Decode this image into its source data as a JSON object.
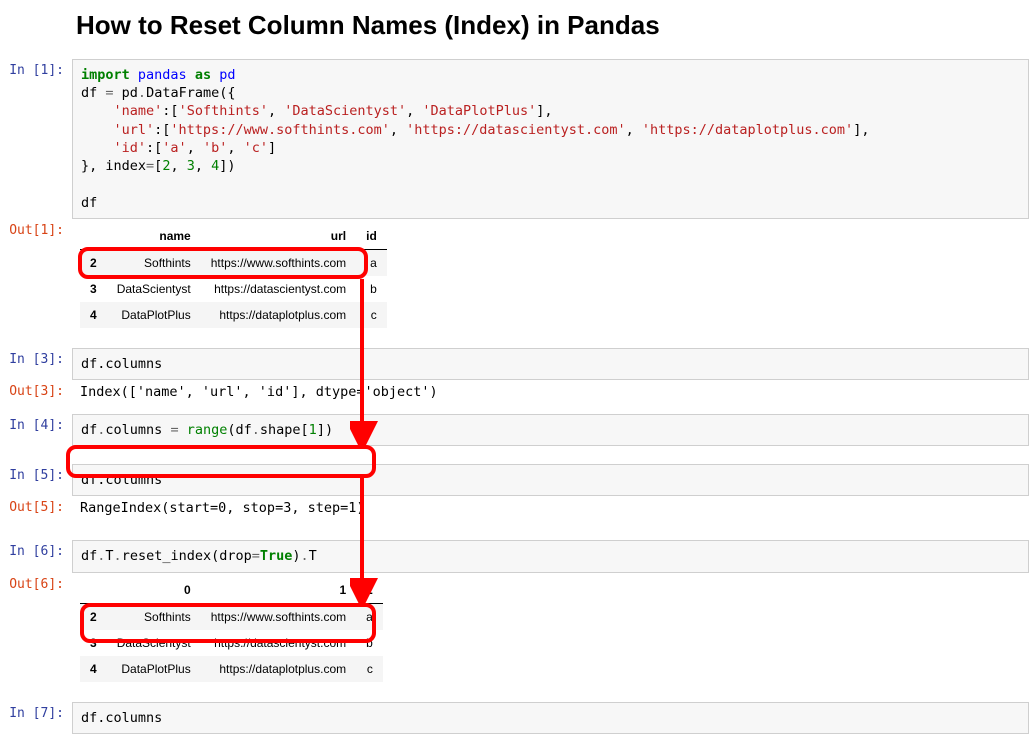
{
  "title": "How to Reset Column Names (Index) in Pandas",
  "cells": {
    "in1": {
      "prompt": "In [1]:",
      "c_import": "import",
      "c_pandas": "pandas",
      "c_as": "as",
      "c_pd": "pd",
      "l2a": "df ",
      "l2_eq": "=",
      "l2b": " pd",
      "l2_dot": ".",
      "l2c": "DataFrame({",
      "l3a": "    ",
      "l3_name": "'name'",
      "l3_col": ":[",
      "l3_s1": "'Softhints'",
      "l3_c1": ", ",
      "l3_s2": "'DataScientyst'",
      "l3_c2": ", ",
      "l3_s3": "'DataPlotPlus'",
      "l3_end": "],",
      "l4a": "    ",
      "l4_url": "'url'",
      "l4_col": ":[",
      "l4_s1": "'https://www.softhints.com'",
      "l4_c1": ", ",
      "l4_s2": "'https://datascientyst.com'",
      "l4_c2": ", ",
      "l4_s3": "'https://dataplotplus.com'",
      "l4_end": "],",
      "l5a": "    ",
      "l5_id": "'id'",
      "l5_col": ":[",
      "l5_s1": "'a'",
      "l5_c1": ", ",
      "l5_s2": "'b'",
      "l5_c2": ", ",
      "l5_s3": "'c'",
      "l5_end": "]",
      "l6a": "}, index",
      "l6_eq": "=",
      "l6_br": "[",
      "l6_n1": "2",
      "l6_c1": ", ",
      "l6_n2": "3",
      "l6_c2": ", ",
      "l6_n3": "4",
      "l6_end": "])",
      "l8": "df"
    },
    "out1": {
      "prompt": "Out[1]:",
      "headers": [
        "",
        "name",
        "url",
        "id"
      ],
      "rows": [
        [
          "2",
          "Softhints",
          "https://www.softhints.com",
          "a"
        ],
        [
          "3",
          "DataScientyst",
          "https://datascientyst.com",
          "b"
        ],
        [
          "4",
          "DataPlotPlus",
          "https://dataplotplus.com",
          "c"
        ]
      ]
    },
    "in3": {
      "prompt": "In [3]:",
      "code": "df.columns"
    },
    "out3": {
      "prompt": "Out[3]:",
      "text": "Index(['name', 'url', 'id'], dtype='object')"
    },
    "in4": {
      "prompt": "In [4]:",
      "t1": "df",
      "t_dot1": ".",
      "t2": "columns ",
      "t_eq": "=",
      "t_sp": " ",
      "t_range": "range",
      "t3": "(df",
      "t_dot2": ".",
      "t4": "shape[",
      "t_one": "1",
      "t5": "])"
    },
    "in5": {
      "prompt": "In [5]:",
      "code": "df.columns"
    },
    "out5": {
      "prompt": "Out[5]:",
      "text": "RangeIndex(start=0, stop=3, step=1)"
    },
    "in6": {
      "prompt": "In [6]:",
      "t1": "df",
      "t_dot1": ".",
      "t2": "T",
      "t_dot2": ".",
      "t3": "reset_index(drop",
      "t_eq": "=",
      "t_true": "True",
      "t4": ")",
      "t_dot3": ".",
      "t5": "T"
    },
    "out6": {
      "prompt": "Out[6]:",
      "headers": [
        "",
        "0",
        "1",
        "2"
      ],
      "rows": [
        [
          "2",
          "Softhints",
          "https://www.softhints.com",
          "a"
        ],
        [
          "3",
          "DataScientyst",
          "https://datascientyst.com",
          "b"
        ],
        [
          "4",
          "DataPlotPlus",
          "https://dataplotplus.com",
          "c"
        ]
      ]
    },
    "in7": {
      "prompt": "In [7]:",
      "code": "df.columns"
    }
  }
}
